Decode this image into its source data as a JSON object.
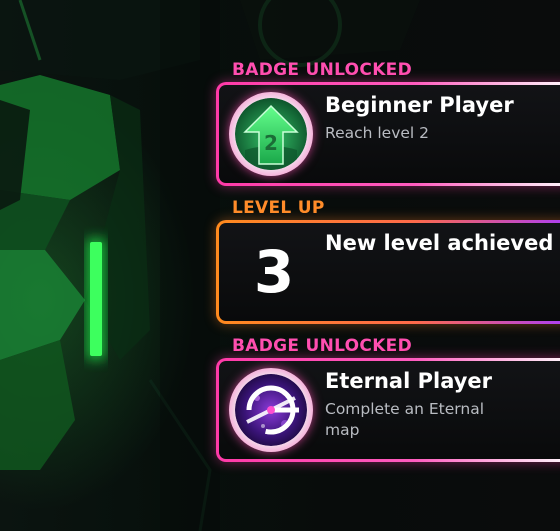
{
  "notifications": [
    {
      "heading": "BADGE UNLOCKED",
      "heading_color": "#ff4fb0",
      "title": "Beginner Player",
      "subtitle": "Reach level 2",
      "icon": "beginner-badge-icon",
      "badge_number": "2"
    },
    {
      "heading": "LEVEL UP",
      "heading_color": "#ff8c2a",
      "level": "3",
      "title": "New level achieved"
    },
    {
      "heading": "BADGE UNLOCKED",
      "heading_color": "#ff4fb0",
      "title": "Eternal Player",
      "subtitle": "Complete an Eternal map",
      "icon": "eternal-badge-icon"
    }
  ],
  "colors": {
    "badge_accent": "#ff3aa8",
    "level_accent": "#ff8a1e",
    "level_accent_end": "#a83cff",
    "world_glow": "#22c24a"
  }
}
